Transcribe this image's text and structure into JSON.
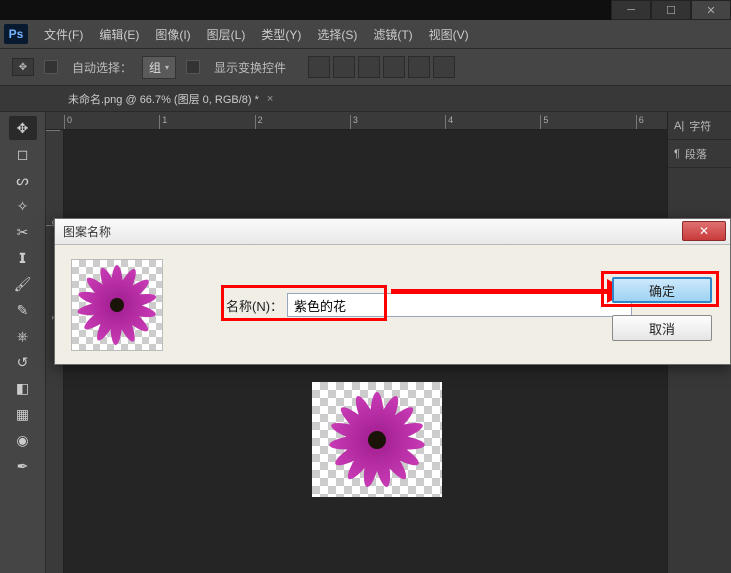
{
  "menu": {
    "file": "文件(F)",
    "edit": "编辑(E)",
    "image": "图像(I)",
    "layer": "图层(L)",
    "type": "类型(Y)",
    "select": "选择(S)",
    "filter": "滤镜(T)",
    "view": "视图(V)"
  },
  "options": {
    "auto_select": "自动选择：",
    "group": "组",
    "show_transform": "显示变换控件"
  },
  "document": {
    "tab_title": "未命名.png @ 66.7% (图层 0, RGB/8) *"
  },
  "ruler": {
    "h": [
      "0",
      "1",
      "2",
      "3",
      "4",
      "5",
      "6"
    ],
    "v": [
      "0",
      "1"
    ]
  },
  "panels": {
    "character": "字符",
    "paragraph": "段落"
  },
  "dialog": {
    "title": "图案名称",
    "name_label": "名称(N)：",
    "name_value": "紫色的花",
    "ok": "确定",
    "cancel": "取消"
  },
  "logo": "Ps"
}
